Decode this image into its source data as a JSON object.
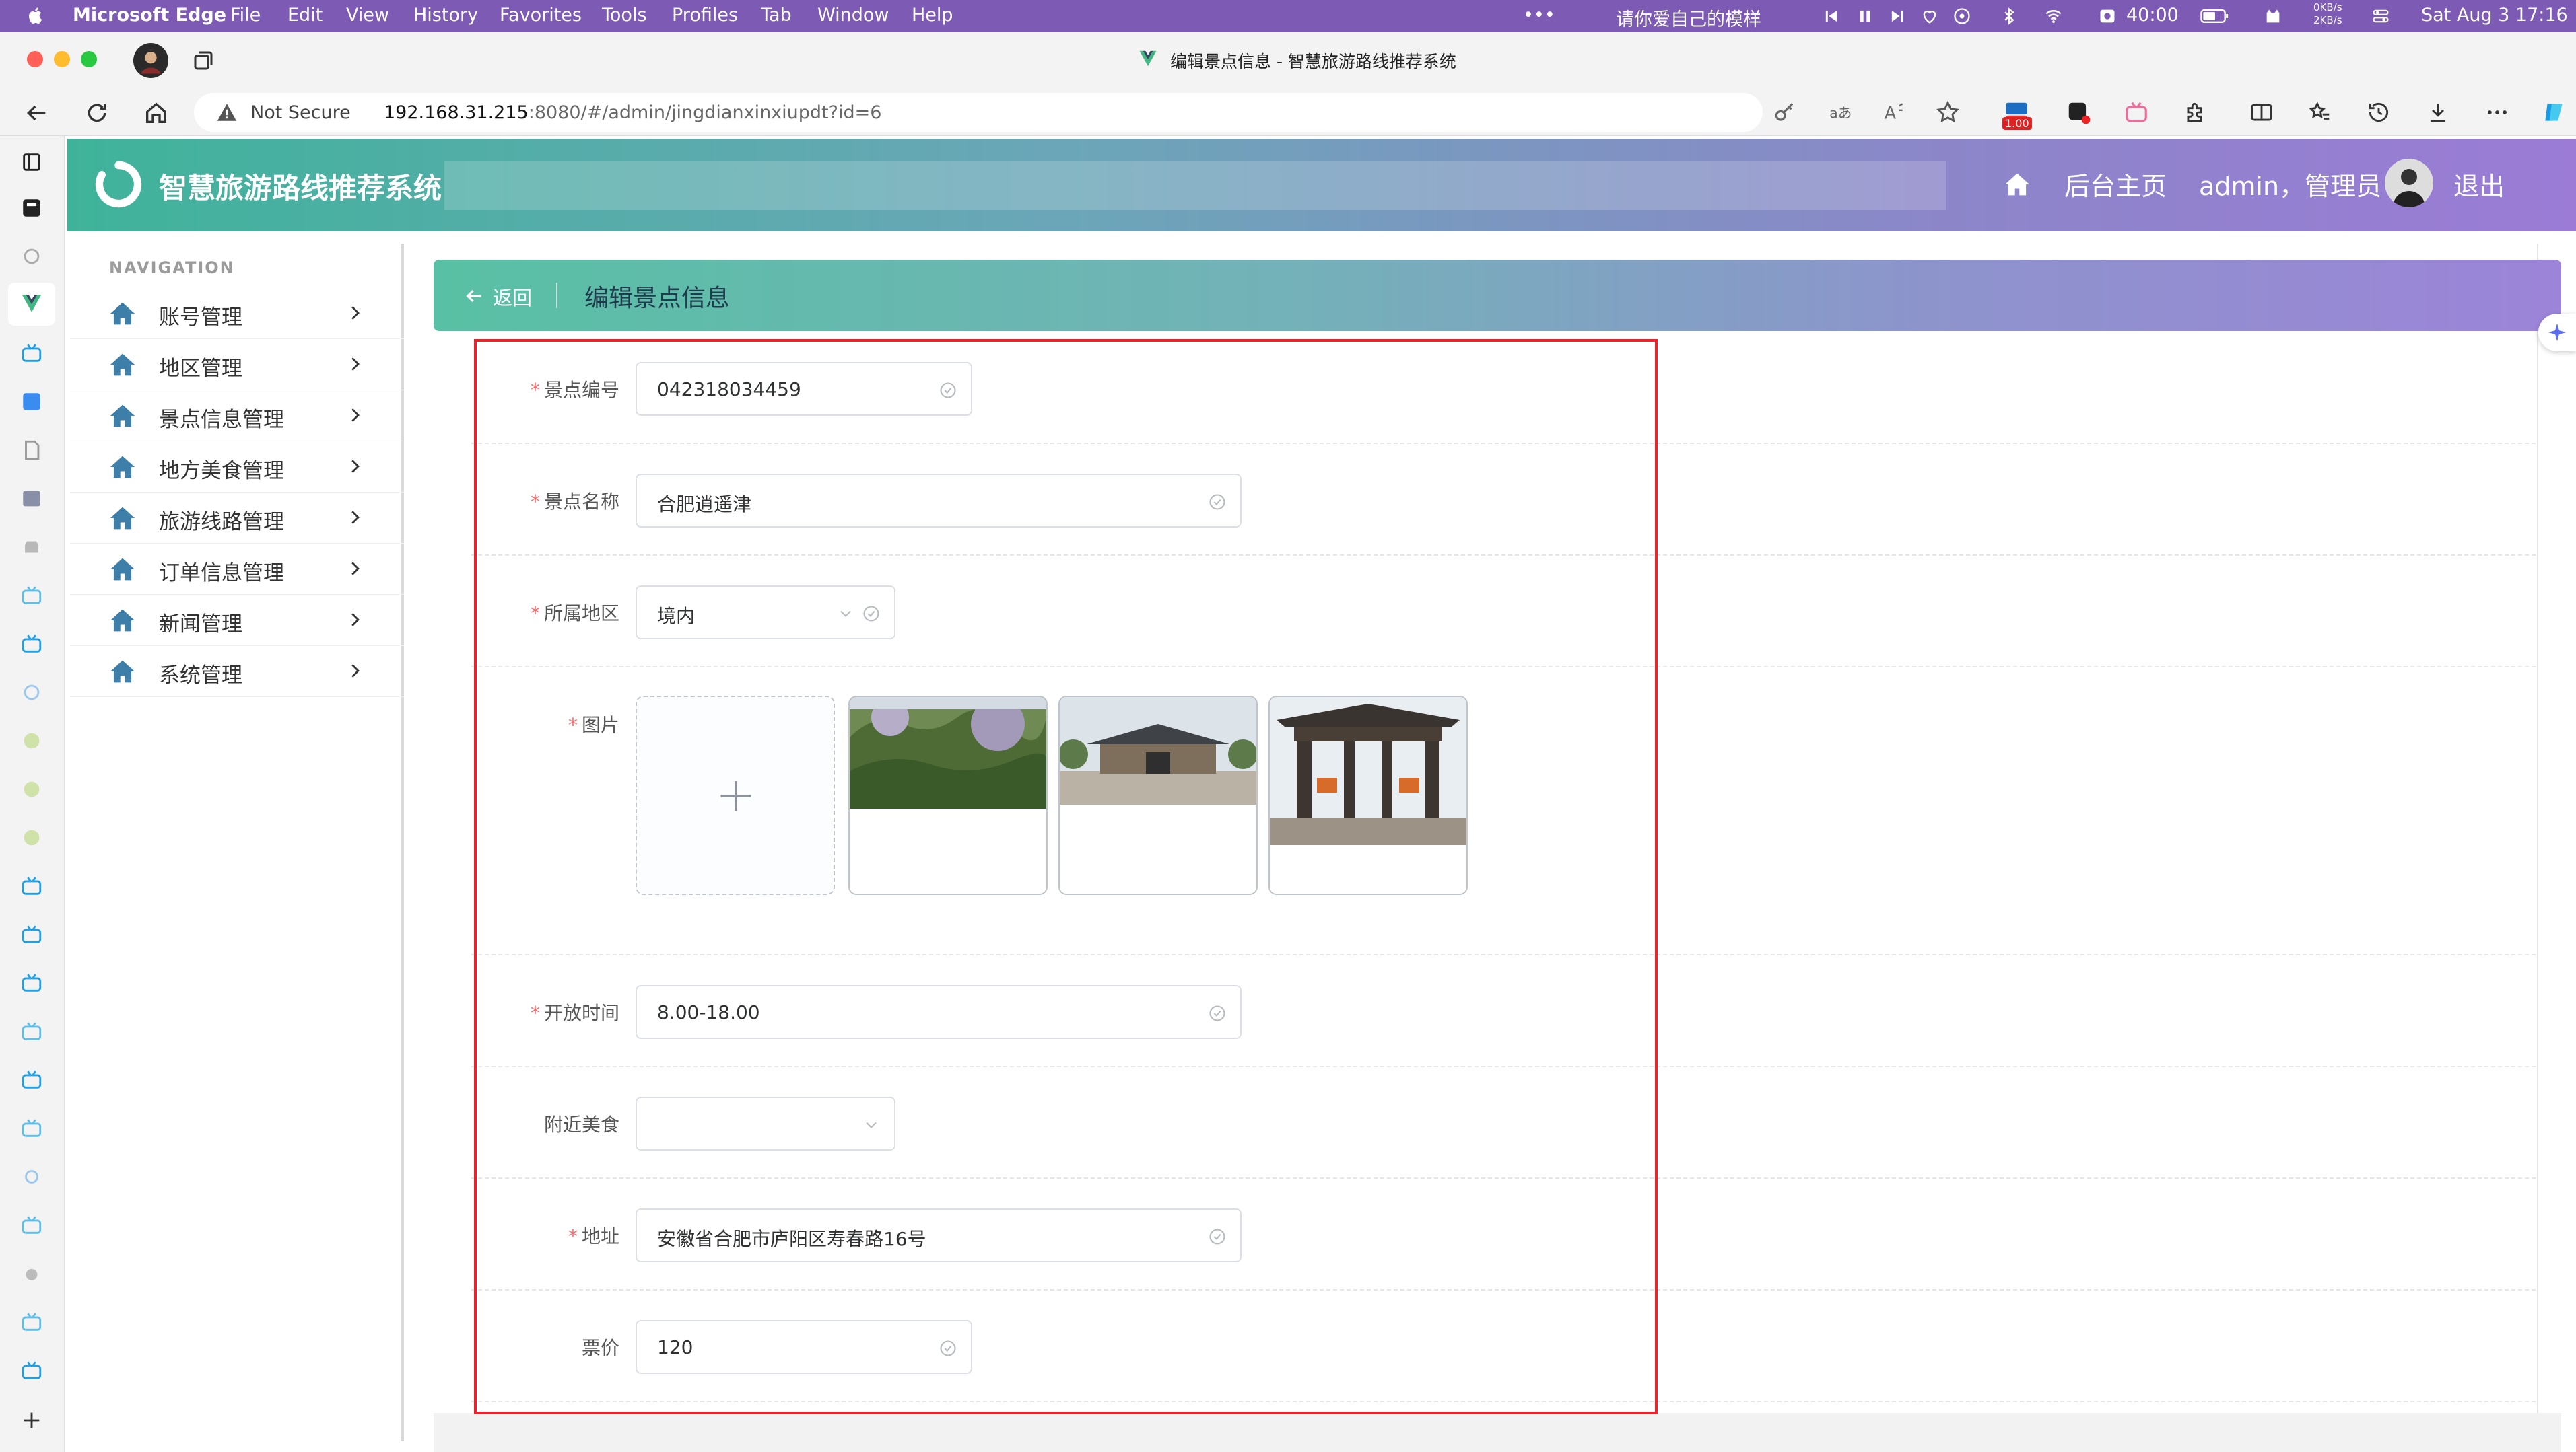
{
  "menubar": {
    "app_name": "Microsoft Edge",
    "menus": [
      "File",
      "Edit",
      "View",
      "History",
      "Favorites",
      "Tools",
      "Profiles",
      "Tab",
      "Window",
      "Help"
    ],
    "more": "•••",
    "now_playing": "请你爱自己的模样",
    "battery_label": "40:00",
    "net_up": "0KB/s",
    "net_down": "2KB/s",
    "datetime": "Sat Aug 3  17:16"
  },
  "browser": {
    "tab_title": "编辑景点信息 - 智慧旅游路线推荐系统",
    "security_label": "Not Secure",
    "url_host": "192.168.31.215",
    "url_rest": ":8080/#/admin/jingdianxinxiupdt?id=6",
    "ext_badge": "1.00"
  },
  "header": {
    "brand": "智慧旅游路线推荐系统",
    "home_link": "后台主页",
    "user": "admin，管理员",
    "logout": "退出"
  },
  "sidebar": {
    "title": "NAVIGATION",
    "items": [
      {
        "label": "账号管理"
      },
      {
        "label": "地区管理"
      },
      {
        "label": "景点信息管理"
      },
      {
        "label": "地方美食管理"
      },
      {
        "label": "旅游线路管理"
      },
      {
        "label": "订单信息管理"
      },
      {
        "label": "新闻管理"
      },
      {
        "label": "系统管理"
      }
    ]
  },
  "page": {
    "back": "返回",
    "title": "编辑景点信息"
  },
  "form": {
    "required_mark": "*",
    "code": {
      "label": "景点编号",
      "value": "042318034459"
    },
    "name": {
      "label": "景点名称",
      "value": "合肥逍遥津"
    },
    "region": {
      "label": "所属地区",
      "value": "境内"
    },
    "images": {
      "label": "图片"
    },
    "hours": {
      "label": "开放时间",
      "value": "8.00-18.00"
    },
    "food": {
      "label": "附近美食",
      "value": ""
    },
    "address": {
      "label": "地址",
      "value": "安徽省合肥市庐阳区寿春路16号"
    },
    "price": {
      "label": "票价",
      "value": "120"
    }
  },
  "colors": {
    "required": "#f56c6c",
    "highlight_frame": "#e3262f",
    "header_start": "#3fb39a",
    "header_end": "#9b7bd6"
  }
}
